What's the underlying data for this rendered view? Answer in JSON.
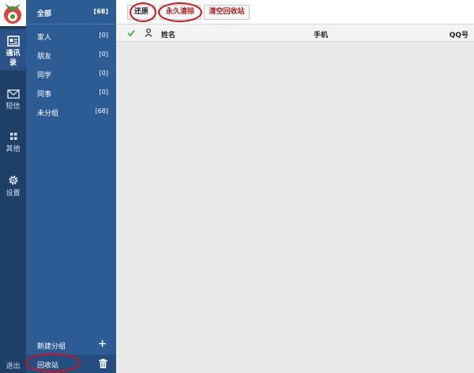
{
  "rail": {
    "items": [
      {
        "label": "通讯录",
        "icon": "contacts-card-icon"
      },
      {
        "label": "短信",
        "icon": "envelope-icon"
      },
      {
        "label": "其他",
        "icon": "grid-icon"
      },
      {
        "label": "设置",
        "icon": "gear-icon"
      }
    ],
    "exit_label": "退出"
  },
  "groups": {
    "all": {
      "name": "全部",
      "count": "[68]"
    },
    "items": [
      {
        "name": "家人",
        "count": "[0]"
      },
      {
        "name": "朋友",
        "count": "[0]"
      },
      {
        "name": "同学",
        "count": "[0]"
      },
      {
        "name": "同事",
        "count": "[0]"
      },
      {
        "name": "未分组",
        "count": "[68]"
      }
    ],
    "new_group_label": "新建分组",
    "recycle_label": "回收站"
  },
  "toolbar": {
    "restore_label": "还原",
    "delete_forever_label": "永久清除",
    "empty_recycle_label": "清空回收站"
  },
  "table": {
    "columns": {
      "name": "姓名",
      "phone": "手机",
      "qq": "QQ号"
    }
  },
  "colors": {
    "rail_bg": "#1e3f66",
    "panel_bg": "#2d5b93",
    "highlight_ring": "#d0141a"
  }
}
